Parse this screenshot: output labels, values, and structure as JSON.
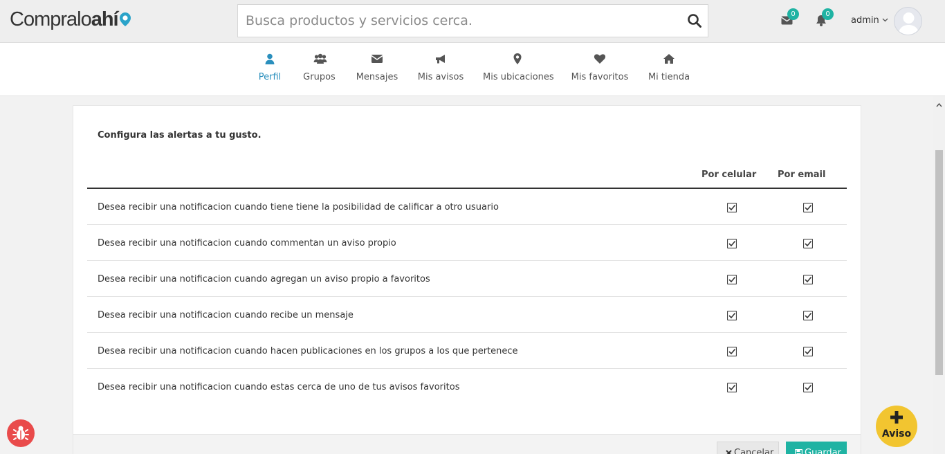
{
  "header": {
    "logo_text": "Compraloahí",
    "search": {
      "placeholder": "Busca productos y servicios cerca."
    },
    "messages_count": "0",
    "notifications_count": "0",
    "user_name": "admin"
  },
  "nav": {
    "items": [
      {
        "label": "Perfil",
        "icon": "user-icon",
        "active": true
      },
      {
        "label": "Grupos",
        "icon": "users-icon"
      },
      {
        "label": "Mensajes",
        "icon": "envelope-icon"
      },
      {
        "label": "Mis avisos",
        "icon": "bullhorn-icon"
      },
      {
        "label": "Mis ubicaciones",
        "icon": "map-marker-icon"
      },
      {
        "label": "Mis favoritos",
        "icon": "heart-icon"
      },
      {
        "label": "Mi tienda",
        "icon": "home-icon"
      }
    ]
  },
  "alerts": {
    "title": "Configura las alertas a tu gusto.",
    "col_phone": "Por celular",
    "col_email": "Por email",
    "rows": [
      {
        "label": "Desea recibir una notificacion cuando tiene tiene la posibilidad de calificar a otro usuario",
        "phone": true,
        "email": true
      },
      {
        "label": "Desea recibir una notificacion cuando commentan un aviso propio",
        "phone": true,
        "email": true
      },
      {
        "label": "Desea recibir una notificacion cuando agregan un aviso propio a favoritos",
        "phone": true,
        "email": true
      },
      {
        "label": "Desea recibir una notificacion cuando recibe un mensaje",
        "phone": true,
        "email": true
      },
      {
        "label": "Desea recibir una notificacion cuando hacen publicaciones en los grupos a los que pertenece",
        "phone": true,
        "email": true
      },
      {
        "label": "Desea recibir una notificacion cuando estas cerca de uno de tus avisos favoritos",
        "phone": true,
        "email": true
      }
    ],
    "cancel_label": "Cancelar",
    "save_label": "Guardar"
  },
  "fab": {
    "label": "Aviso"
  },
  "colors": {
    "accent": "#1fb3a3",
    "active_nav": "#2a8fbd",
    "fab": "#f2c530",
    "bug": "#e94b4b"
  }
}
